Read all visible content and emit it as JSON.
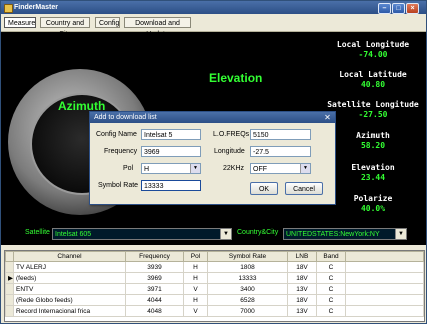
{
  "window": {
    "title": "FinderMaster"
  },
  "tabs": [
    "Measure",
    "Country and City",
    "Config",
    "Download and Update"
  ],
  "gauge": {
    "azimuth_label": "Azimuth"
  },
  "elevation_title": "Elevation",
  "info": [
    {
      "label": "Local Longitude",
      "value": "-74.00"
    },
    {
      "label": "Local Latitude",
      "value": "40.80"
    },
    {
      "label": "Satellite Longitude",
      "value": "-27.50"
    },
    {
      "label": "Azimuth",
      "value": "58.20"
    },
    {
      "label": "Elevation",
      "value": "23.44"
    },
    {
      "label": "Polarize",
      "value": "40.0%"
    }
  ],
  "selectors": {
    "satellite_label": "Satellite",
    "satellite_value": "Intelsat 605",
    "country_label": "Country&City",
    "country_value": "UNITEDSTATES:NewYork:NY"
  },
  "dialog": {
    "title": "Add to download list",
    "config_name_label": "Config Name",
    "config_name": "Intelsat 5",
    "lofreq_label": "L.O.FREQs",
    "lofreq": "5150",
    "frequency_label": "Frequency",
    "frequency": "3969",
    "longitude_label": "Longitude",
    "longitude": "-27.5",
    "pol_label": "Pol",
    "pol": "H",
    "khz_label": "22KHz",
    "khz": "OFF",
    "symbol_label": "Symbol Rate",
    "symbol": "13333",
    "ok_label": "OK",
    "cancel_label": "Cancel"
  },
  "table": {
    "headers": [
      "Channel",
      "Frequency",
      "Pol",
      "Symbol Rate",
      "LNB",
      "Band"
    ],
    "rows": [
      [
        "TV ALERJ",
        "3939",
        "H",
        "1808",
        "18V",
        "C"
      ],
      [
        "(feeds)",
        "3969",
        "H",
        "13333",
        "18V",
        "C"
      ],
      [
        "ENTV",
        "3971",
        "V",
        "3400",
        "13V",
        "C"
      ],
      [
        "(Rede Globo feeds)",
        "4044",
        "H",
        "6528",
        "18V",
        "C"
      ],
      [
        "Record Internacional frica",
        "4048",
        "V",
        "7000",
        "13V",
        "C"
      ]
    ],
    "current_row": 1
  }
}
